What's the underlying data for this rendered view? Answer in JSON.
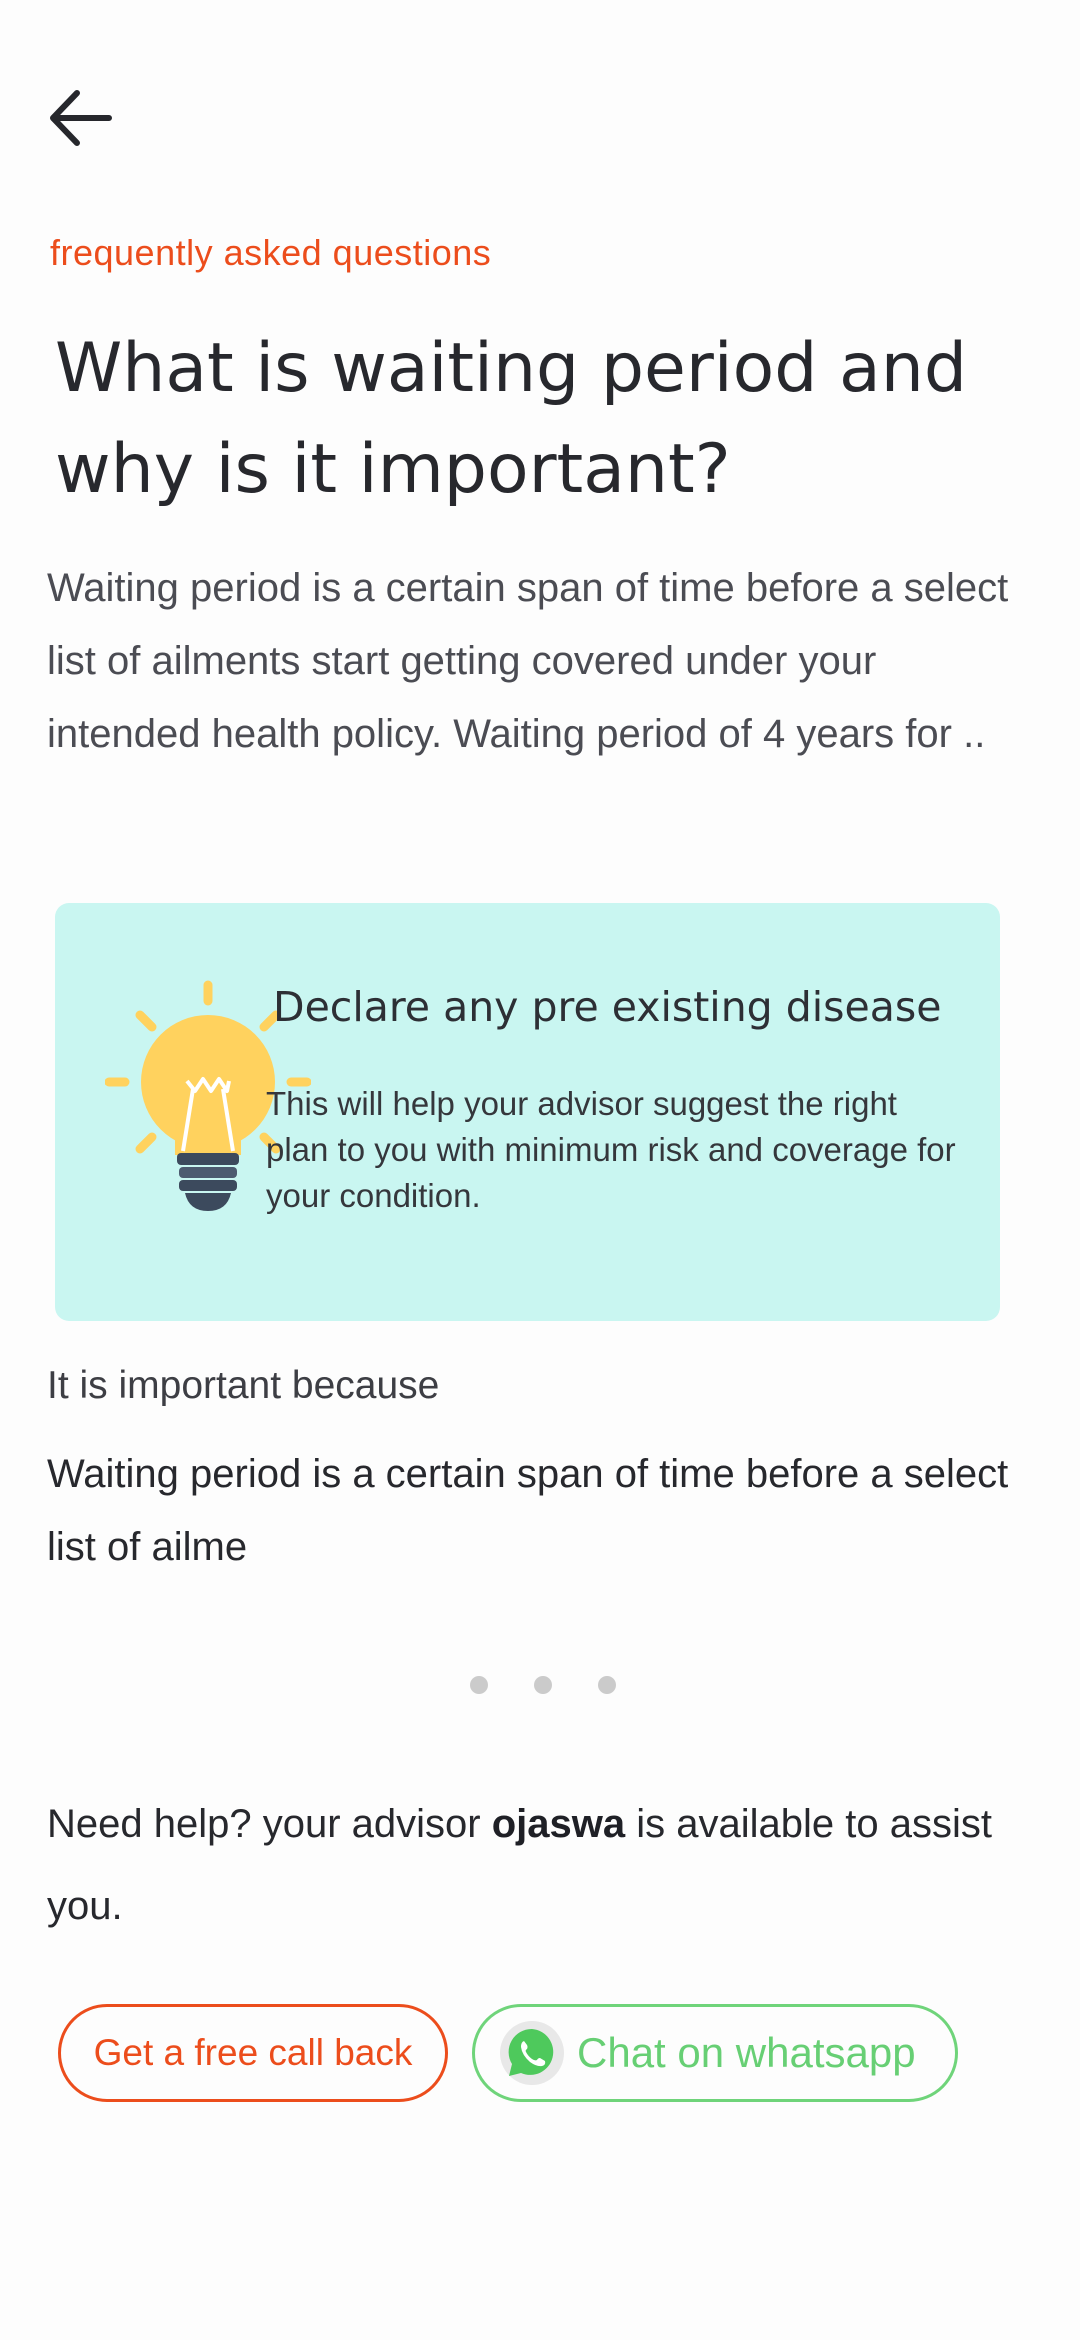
{
  "header": {
    "back_icon": "arrow-left-icon",
    "eyebrow": "frequently asked questions"
  },
  "faq": {
    "title": "What is waiting period and why is it important?",
    "intro": "Waiting period is a certain span of time before a select list of ailments start getting covered under your intended health policy. Waiting period of 4 years for .."
  },
  "tip_card": {
    "icon": "lightbulb-icon",
    "title": "Declare any pre existing disease",
    "text": "This will help your advisor suggest the right plan to you with minimum risk and coverage for your condition.",
    "background": "#c9f6f1"
  },
  "importance": {
    "heading": "It is important because",
    "text": "Waiting period is a certain span of time before a select list of ailme"
  },
  "pagination": {
    "count": 3
  },
  "help": {
    "prefix": "Need help? your advisor ",
    "advisor_name": "ojaswa",
    "suffix": " is available to assist you."
  },
  "actions": {
    "callback_label": "Get a free call back",
    "whatsapp_label": "Chat on whatsapp",
    "whatsapp_icon": "whatsapp-icon"
  },
  "colors": {
    "accent": "#ec4d1c",
    "whatsapp": "#67cf74",
    "text": "#27282d"
  }
}
